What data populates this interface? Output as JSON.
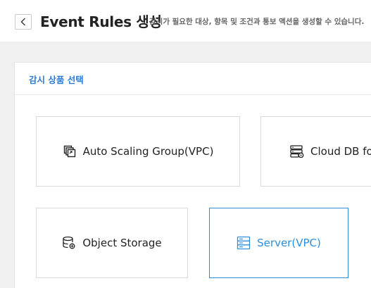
{
  "header": {
    "back_icon": "chevron-left-icon",
    "title": "Event Rules 생성",
    "description": "감시가 필요한 대상, 항목 및 조건과 통보 액션을 생성할 수 있습니다."
  },
  "panel": {
    "title": "감시 상품 선택"
  },
  "products": [
    {
      "label": "Auto Scaling Group(VPC)",
      "icon": "copy-stack-icon",
      "selected": false
    },
    {
      "label": "Cloud DB for",
      "icon": "database-server-icon",
      "selected": false
    },
    {
      "label": "Object Storage",
      "icon": "database-icon",
      "selected": false
    },
    {
      "label": "Server(VPC)",
      "icon": "server-icon",
      "selected": true
    }
  ],
  "colors": {
    "accent": "#2e8ed9",
    "panel_title": "#2b7bd2",
    "background": "#f0f0f0"
  }
}
